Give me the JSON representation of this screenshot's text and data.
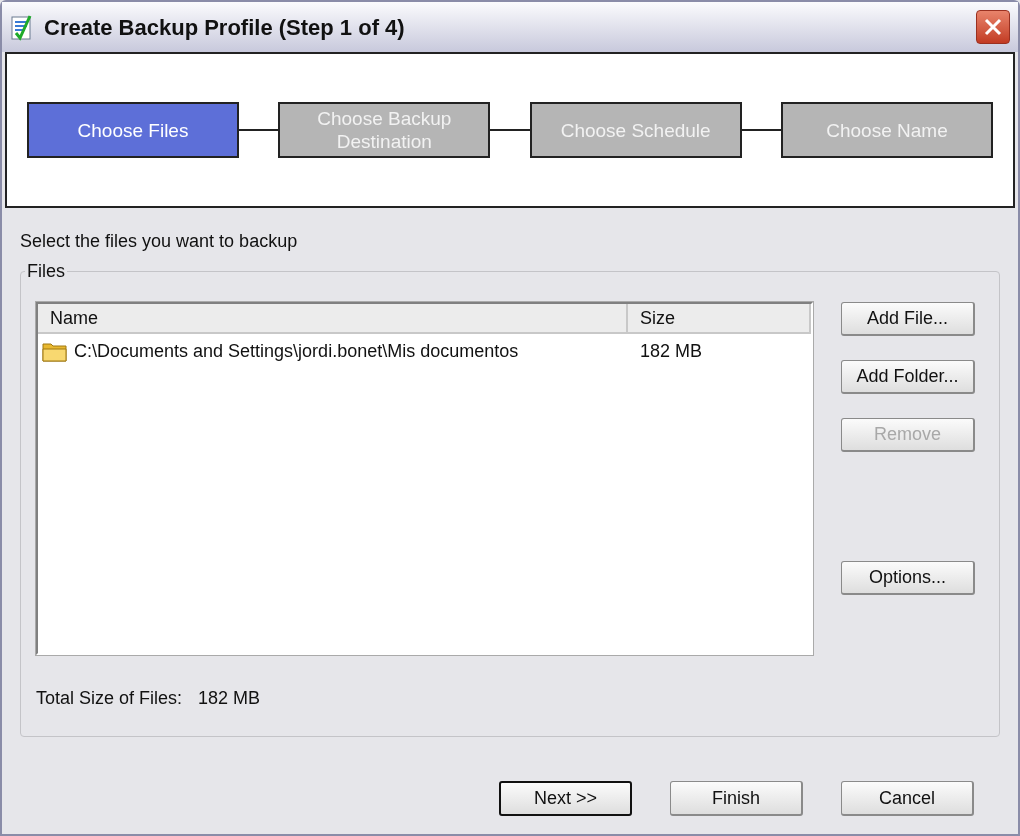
{
  "window": {
    "title": "Create Backup Profile (Step 1 of 4)"
  },
  "steps": [
    {
      "label": "Choose Files",
      "selected": true
    },
    {
      "label": "Choose Backup Destination",
      "selected": false
    },
    {
      "label": "Choose Schedule",
      "selected": false
    },
    {
      "label": "Choose Name",
      "selected": false
    }
  ],
  "instruction": "Select the files you want to backup",
  "files_group": {
    "title": "Files",
    "table": {
      "columns": [
        "Name",
        "Size"
      ],
      "rows": [
        {
          "name": "C:\\Documents and Settings\\jordi.bonet\\Mis documentos",
          "size": "182 MB"
        }
      ]
    },
    "buttons": [
      {
        "label": "Add File...",
        "disabled": false
      },
      {
        "label": "Add Folder...",
        "disabled": false
      },
      {
        "label": "Remove",
        "disabled": true
      },
      {
        "label": "Options...",
        "disabled": false
      }
    ],
    "total_label": "Total Size of Files:",
    "total_value": "182 MB"
  },
  "footer_buttons": [
    {
      "label": "Next >>",
      "default": true
    },
    {
      "label": "Finish",
      "default": false
    },
    {
      "label": "Cancel",
      "default": false
    }
  ]
}
